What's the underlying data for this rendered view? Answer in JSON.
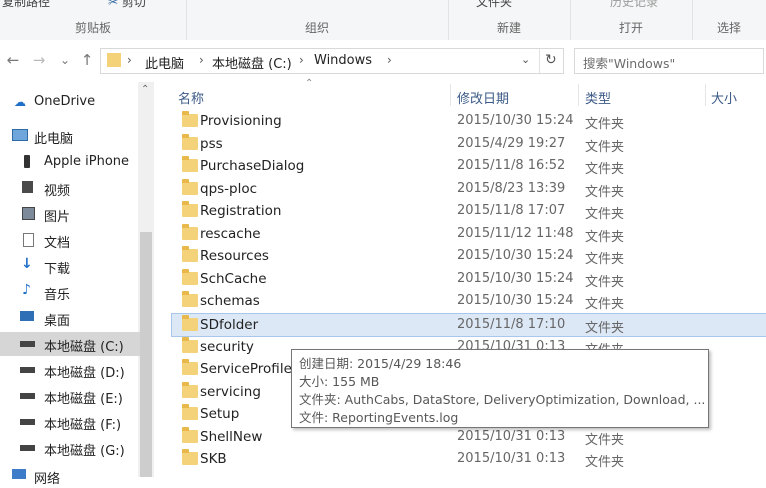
{
  "ribbon": {
    "top_left_text": "复制路径",
    "cut_label": "剪切",
    "groups": [
      "剪贴板",
      "组织",
      "新建",
      "打开",
      "选择"
    ],
    "new_folder_label": "文件夹",
    "edit_label": "历史记录"
  },
  "nav": {
    "back": "←",
    "forward": "→",
    "recent": "⌄",
    "up": "↑",
    "path": [
      "此电脑",
      "本地磁盘 (C:)",
      "Windows"
    ],
    "refresh": "↻",
    "search_placeholder": "搜索\"Windows\""
  },
  "sidebar": {
    "items": [
      {
        "label": "OneDrive",
        "icon": "cloud-icon"
      },
      {
        "label": "此电脑",
        "icon": "computer-icon"
      },
      {
        "label": "Apple iPhone",
        "icon": "phone-icon"
      },
      {
        "label": "视频",
        "icon": "video-icon"
      },
      {
        "label": "图片",
        "icon": "picture-icon"
      },
      {
        "label": "文档",
        "icon": "document-icon"
      },
      {
        "label": "下载",
        "icon": "download-icon"
      },
      {
        "label": "音乐",
        "icon": "music-icon"
      },
      {
        "label": "桌面",
        "icon": "desktop-icon"
      },
      {
        "label": "本地磁盘 (C:)",
        "icon": "drive-icon"
      },
      {
        "label": "本地磁盘 (D:)",
        "icon": "drive-icon"
      },
      {
        "label": "本地磁盘 (E:)",
        "icon": "drive-icon"
      },
      {
        "label": "本地磁盘 (F:)",
        "icon": "drive-icon"
      },
      {
        "label": "本地磁盘 (G:)",
        "icon": "drive-icon"
      },
      {
        "label": "网络",
        "icon": "network-icon"
      }
    ]
  },
  "columns": {
    "name": "名称",
    "date": "修改日期",
    "type": "类型",
    "size": "大小"
  },
  "files": [
    {
      "name": "Provisioning",
      "date": "2015/10/30 15:24",
      "type": "文件夹"
    },
    {
      "name": "pss",
      "date": "2015/4/29 19:27",
      "type": "文件夹"
    },
    {
      "name": "PurchaseDialog",
      "date": "2015/11/8 16:52",
      "type": "文件夹"
    },
    {
      "name": "qps-ploc",
      "date": "2015/8/23 13:39",
      "type": "文件夹"
    },
    {
      "name": "Registration",
      "date": "2015/11/8 17:07",
      "type": "文件夹"
    },
    {
      "name": "rescache",
      "date": "2015/11/12 11:48",
      "type": "文件夹"
    },
    {
      "name": "Resources",
      "date": "2015/10/30 15:24",
      "type": "文件夹"
    },
    {
      "name": "SchCache",
      "date": "2015/10/30 15:24",
      "type": "文件夹"
    },
    {
      "name": "schemas",
      "date": "2015/10/30 15:24",
      "type": "文件夹"
    },
    {
      "name": "SDfolder",
      "date": "2015/11/8 17:10",
      "type": "文件夹"
    },
    {
      "name": "security",
      "date": "2015/10/31 0:13",
      "type": "文件夹"
    },
    {
      "name": "ServiceProfiles",
      "date": "",
      "type": ""
    },
    {
      "name": "servicing",
      "date": "",
      "type": ""
    },
    {
      "name": "Setup",
      "date": "",
      "type": ""
    },
    {
      "name": "ShellNew",
      "date": "2015/10/31 0:13",
      "type": "文件夹"
    },
    {
      "name": "SKB",
      "date": "2015/10/31 0:13",
      "type": "文件夹"
    }
  ],
  "tooltip": {
    "created": "创建日期: 2015/4/29 18:46",
    "size": "大小: 155 MB",
    "folders": "文件夹: AuthCabs, DataStore, DeliveryOptimization, Download, ...",
    "files": "文件: ReportingEvents.log"
  }
}
